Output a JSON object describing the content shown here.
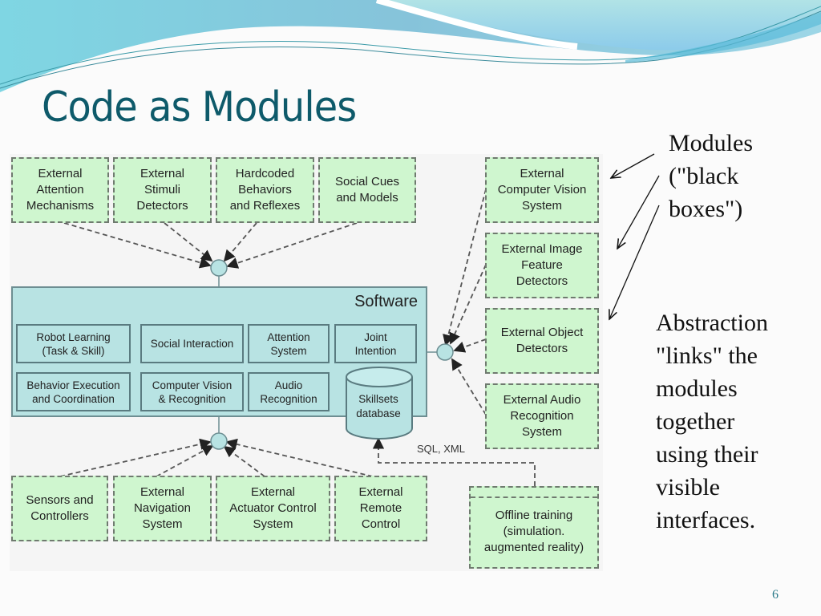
{
  "slide": {
    "title": "Code as Modules",
    "page_number": "6",
    "colors": {
      "title": "#0e5a6a",
      "module_fill": "#cff6cf",
      "software_fill": "#b8e3e3",
      "wave_dark": "#7fc3dd",
      "wave_light": "#a8e0e8"
    }
  },
  "annotations": {
    "modules_note": "Modules\n(\"black\nboxes\")",
    "abstraction_note": "Abstraction\n\"links\" the\nmodules\ntogether\nusing their\nvisible\ninterfaces."
  },
  "diagram": {
    "top_modules": [
      {
        "label": "External\nAttention\nMechanisms"
      },
      {
        "label": "External\nStimuli\nDetectors"
      },
      {
        "label": "Hardcoded\nBehaviors\nand Reflexes"
      },
      {
        "label": "Social Cues\nand Models"
      }
    ],
    "right_modules": [
      {
        "label": "External\nComputer Vision\nSystem"
      },
      {
        "label": "External Image\nFeature\nDetectors"
      },
      {
        "label": "External Object\nDetectors"
      },
      {
        "label": "External Audio\nRecognition\nSystem"
      }
    ],
    "bottom_modules": [
      {
        "label": "Sensors and\nControllers"
      },
      {
        "label": "External\nNavigation\nSystem"
      },
      {
        "label": "External\nActuator Control\nSystem"
      },
      {
        "label": "External\nRemote\nControl"
      }
    ],
    "offline_module": {
      "label": "Offline training\n(simulation.\naugmented reality)"
    },
    "software": {
      "label": "Software",
      "components": [
        {
          "label": "Robot Learning\n(Task & Skill)"
        },
        {
          "label": "Social Interaction"
        },
        {
          "label": "Attention\nSystem"
        },
        {
          "label": "Joint\nIntention"
        },
        {
          "label": "Behavior Execution\nand Coordination"
        },
        {
          "label": "Computer Vision\n& Recognition"
        },
        {
          "label": "Audio\nRecognition"
        }
      ],
      "database": {
        "label": "Skillsets\ndatabase"
      }
    },
    "link_label": "SQL, XML"
  }
}
